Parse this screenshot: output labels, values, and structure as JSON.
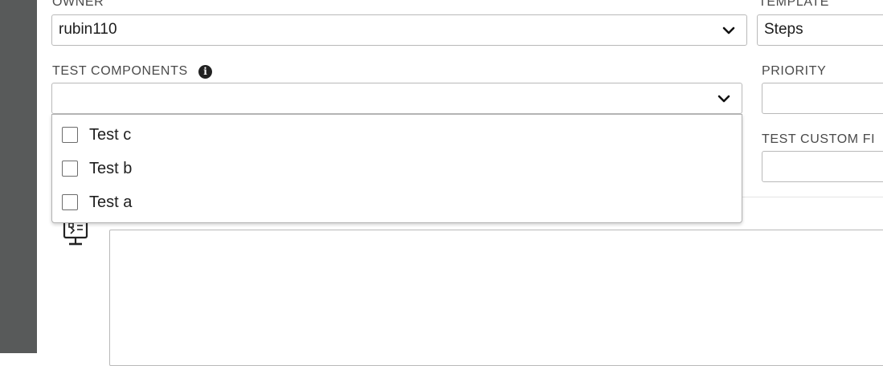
{
  "owner": {
    "label": "OWNER",
    "value": "rubin110"
  },
  "template": {
    "label": "TEMPLATE",
    "value": "Steps"
  },
  "test_components": {
    "label": "TEST COMPONENTS",
    "value": "",
    "options": [
      {
        "label": "Test c",
        "checked": false
      },
      {
        "label": "Test b",
        "checked": false
      },
      {
        "label": "Test a",
        "checked": false
      }
    ]
  },
  "priority": {
    "label": "PRIORITY",
    "value": ""
  },
  "test_custom_field": {
    "label": "TEST CUSTOM FI",
    "value": ""
  },
  "description": {
    "value": ""
  },
  "icons": {
    "info": "info-circle-icon",
    "chevron": "chevron-down-icon",
    "editor": "monitor-editor-icon"
  },
  "colors": {
    "left_rail": "#585a5a",
    "border": "#b9b9b9"
  }
}
